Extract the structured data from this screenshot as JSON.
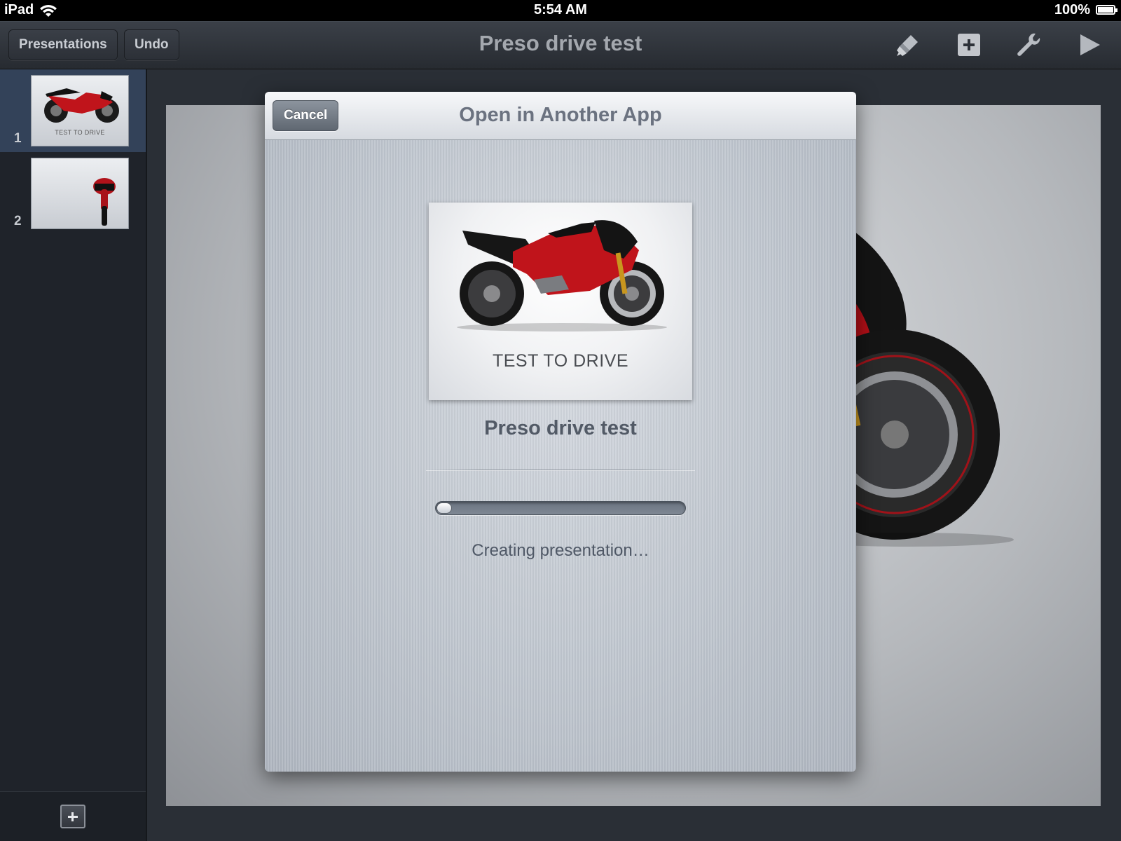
{
  "status_bar": {
    "device": "iPad",
    "time": "5:54 AM",
    "battery": "100%"
  },
  "toolbar": {
    "presentations_label": "Presentations",
    "undo_label": "Undo",
    "title": "Preso drive test",
    "icons": [
      "paintbrush-icon",
      "add-icon",
      "wrench-icon",
      "play-icon"
    ]
  },
  "sidebar": {
    "slides": [
      {
        "number": "1",
        "caption": "TEST TO DRIVE",
        "selected": true
      },
      {
        "number": "2",
        "caption": "",
        "selected": false
      }
    ]
  },
  "dialog": {
    "title": "Open in Another App",
    "cancel_label": "Cancel",
    "preview_caption": "TEST TO DRIVE",
    "file_name": "Preso drive test",
    "progress": 0.04,
    "status": "Creating presentation…"
  },
  "colors": {
    "toolbar": "#2f343b",
    "sidebar_selected": "#334259",
    "motorcycle_red": "#c0141b"
  }
}
